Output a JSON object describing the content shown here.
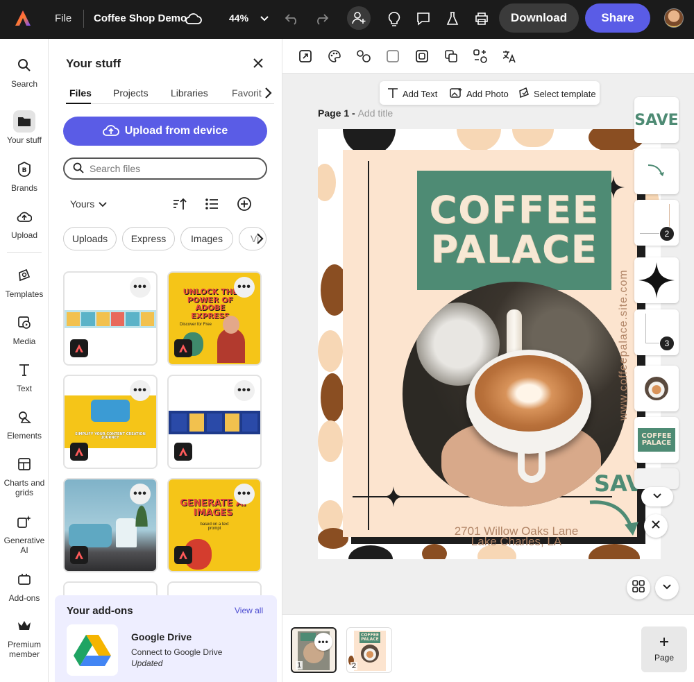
{
  "topbar": {
    "file_label": "File",
    "doc_title": "Coffee Shop Demo",
    "zoom": "44%",
    "download_label": "Download",
    "share_label": "Share"
  },
  "rail": {
    "items": [
      {
        "label": "Search",
        "icon": "search-icon"
      },
      {
        "label": "Your stuff",
        "icon": "folder-icon"
      },
      {
        "label": "Brands",
        "icon": "brand-icon"
      },
      {
        "label": "Upload",
        "icon": "upload-icon"
      },
      {
        "label": "Templates",
        "icon": "templates-icon"
      },
      {
        "label": "Media",
        "icon": "media-icon"
      },
      {
        "label": "Text",
        "icon": "text-icon"
      },
      {
        "label": "Elements",
        "icon": "elements-icon"
      },
      {
        "label": "Charts and grids",
        "icon": "charts-icon"
      },
      {
        "label": "Generative AI",
        "icon": "sparkle-icon"
      },
      {
        "label": "Add-ons",
        "icon": "addons-icon"
      },
      {
        "label": "Premium member",
        "icon": "crown-icon"
      }
    ]
  },
  "panel": {
    "title": "Your stuff",
    "tabs": [
      "Files",
      "Projects",
      "Libraries",
      "Favorit"
    ],
    "upload_label": "Upload from device",
    "search_placeholder": "Search files",
    "owner_filter": "Yours",
    "chips": [
      "Uploads",
      "Express",
      "Images",
      "Vi"
    ],
    "cards": [
      {
        "text": ""
      },
      {
        "text": "UNLOCK THE POWER OF ADOBE EXPRESS",
        "sub": "Discover for Free"
      },
      {
        "text": "SIMPLIFY YOUR CONTENT CREATION JOURNEY"
      },
      {
        "text": ""
      },
      {
        "text": ""
      },
      {
        "text": "GENERATE AI IMAGES",
        "sub": "based on a text prompt"
      }
    ],
    "addons": {
      "title": "Your add-ons",
      "view_all": "View all",
      "item_name": "Google Drive",
      "item_desc": "Connect to Google Drive",
      "item_status": "Updated"
    }
  },
  "quick_actions": [
    "Add Text",
    "Add Photo",
    "Select template"
  ],
  "page": {
    "label": "Page 1 -",
    "title_placeholder": "Add title"
  },
  "poster": {
    "title_line1": "COFFEE",
    "title_line2": "PALACE",
    "website": "www.coffeepalace.site.com",
    "save": "SAVE",
    "address_line1": "2701 Willow Oaks Lane",
    "address_line2": "Lake Charles, LA"
  },
  "strip": {
    "save_text": "SAVE",
    "num2": "2",
    "num3": "3",
    "logo_line1": "COFFEE",
    "logo_line2": "PALACE"
  },
  "pagebar": {
    "pages": [
      "1",
      "2"
    ],
    "thumb_title": "COFFEE PALACE",
    "add_page_label": "Page"
  },
  "colors": {
    "accent": "#5a5ce6",
    "topbar": "#1b1b1b",
    "poster_green": "#4e8b74",
    "poster_cream": "#fce4cf",
    "poster_brown": "#b08466"
  }
}
